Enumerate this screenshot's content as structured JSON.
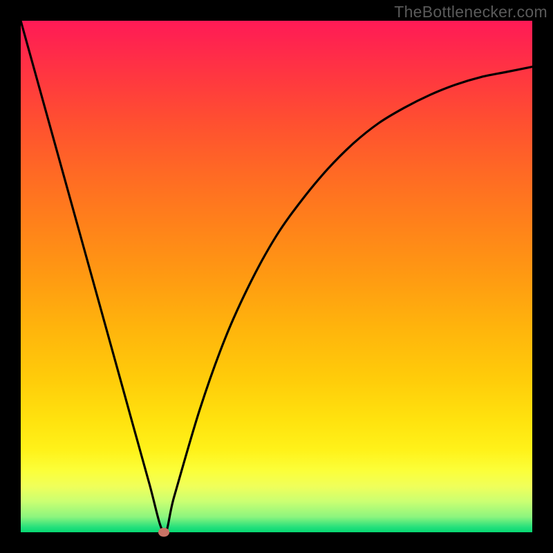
{
  "attribution": "TheBottlenecker.com",
  "chart_data": {
    "type": "line",
    "title": "",
    "xlabel": "",
    "ylabel": "",
    "xlim": [
      0,
      100
    ],
    "ylim": [
      0,
      100
    ],
    "series": [
      {
        "name": "bottleneck-curve",
        "x": [
          0,
          5,
          10,
          15,
          20,
          25,
          28,
          30,
          35,
          40,
          45,
          50,
          55,
          60,
          65,
          70,
          75,
          80,
          85,
          90,
          95,
          100
        ],
        "values": [
          100,
          82,
          64,
          46,
          28,
          10,
          0,
          7,
          24,
          38,
          49,
          58,
          65,
          71,
          76,
          80,
          83,
          85.5,
          87.5,
          89,
          90,
          91
        ]
      }
    ],
    "marker": {
      "x": 28,
      "y": 0,
      "color": "#c97366"
    },
    "background_gradient": {
      "top": "#ff1a56",
      "mid": "#ffcc0a",
      "bottom": "#06d872"
    }
  }
}
